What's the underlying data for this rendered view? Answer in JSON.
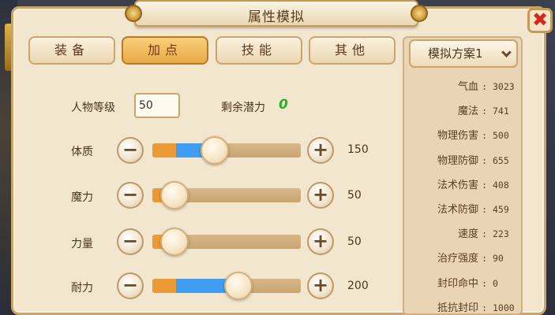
{
  "window": {
    "title": "属性模拟",
    "close_glyph": "✖"
  },
  "tabs": [
    {
      "label": "装备",
      "active": false
    },
    {
      "label": "加点",
      "active": true
    },
    {
      "label": "技能",
      "active": false
    },
    {
      "label": "其他",
      "active": false
    }
  ],
  "level": {
    "label": "人物等级",
    "value": "50"
  },
  "potential": {
    "label": "剩余潜力",
    "value": "0"
  },
  "attributes": [
    {
      "label": "体质",
      "value": "150",
      "level": 0.42,
      "base": 0.16
    },
    {
      "label": "魔力",
      "value": "50",
      "level": 0.15,
      "base": 0.15
    },
    {
      "label": "力量",
      "value": "50",
      "level": 0.15,
      "base": 0.15
    },
    {
      "label": "耐力",
      "value": "200",
      "level": 0.58,
      "base": 0.16
    }
  ],
  "controls": {
    "minus_glyph": "−",
    "plus_glyph": "+"
  },
  "plan": {
    "label": "模拟方案1"
  },
  "stats": [
    {
      "name": "气血",
      "value": ": 3023"
    },
    {
      "name": "魔法",
      "value": ": 741"
    },
    {
      "name": "物理伤害",
      "value": ": 500"
    },
    {
      "name": "物理防御",
      "value": ": 655"
    },
    {
      "name": "法术伤害",
      "value": ": 408"
    },
    {
      "name": "法术防御",
      "value": ": 459"
    },
    {
      "name": "速度",
      "value": ": 223"
    },
    {
      "name": "治疗强度",
      "value": ": 90"
    },
    {
      "name": "封印命中",
      "value": ": 0"
    },
    {
      "name": "抵抗封印",
      "value": ": 1000"
    }
  ],
  "colors": {
    "panel_bg": "#f3e6cf",
    "tab_active": "#e9a947",
    "bar_blue": "#3f9ef2",
    "bar_orange": "#ec9a36",
    "potential_green": "#22b22a",
    "close_red": "#d22a1c"
  }
}
